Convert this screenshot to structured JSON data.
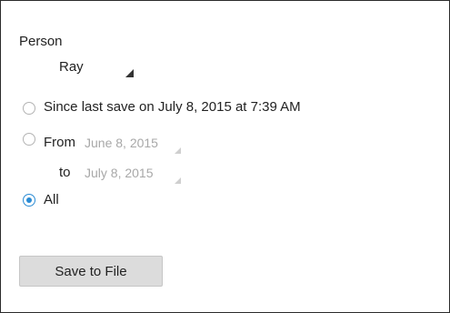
{
  "person": {
    "label": "Person",
    "selected": "Ray"
  },
  "options": {
    "since_last_save": "Since last save on July 8, 2015 at 7:39 AM",
    "from_label": "From",
    "from_date": "June 8, 2015",
    "to_label": "to",
    "to_date": "July 8, 2015",
    "all": "All",
    "selected": "All"
  },
  "actions": {
    "save_label": "Save to File"
  },
  "colors": {
    "accent": "#2a8bd4",
    "button_bg": "#dcdcdc",
    "disabled_text": "#a8a8a8"
  }
}
